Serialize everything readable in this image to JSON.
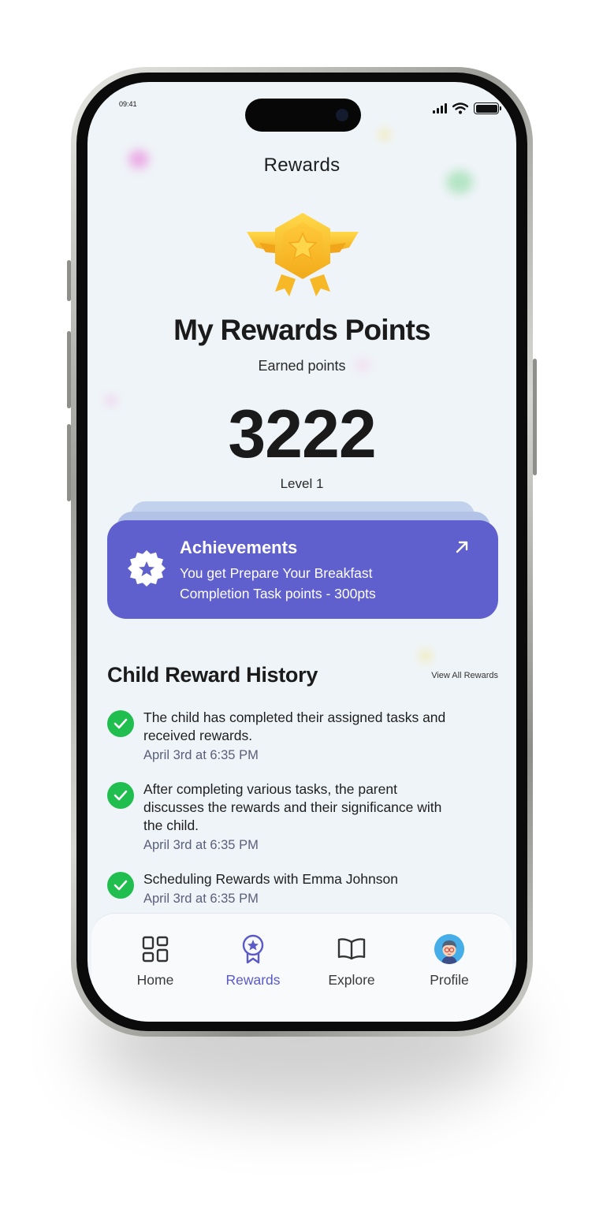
{
  "status_bar": {
    "time": "09:41"
  },
  "header": {
    "title": "Rewards"
  },
  "points": {
    "title": "My Rewards Points",
    "subtitle": "Earned points",
    "value": "3222",
    "level": "Level 1"
  },
  "achievement": {
    "title": "Achievements",
    "text": "You get Prepare Your Breakfast Completion Task points - 300pts"
  },
  "history": {
    "title": "Child Reward History",
    "view_all": "View All Rewards",
    "items": [
      {
        "text": "The child has completed their assigned tasks and received rewards.",
        "time": "April 3rd at 6:35 PM"
      },
      {
        "text": "After completing various tasks, the parent discusses the rewards and their significance with the child.",
        "time": "April 3rd at 6:35 PM"
      },
      {
        "text": "Scheduling Rewards with Emma Johnson",
        "time": "April 3rd at 6:35 PM"
      }
    ]
  },
  "tabs": [
    {
      "label": "Home",
      "icon": "grid-icon",
      "active": false
    },
    {
      "label": "Rewards",
      "icon": "medal-icon",
      "active": true
    },
    {
      "label": "Explore",
      "icon": "book-icon",
      "active": false
    },
    {
      "label": "Profile",
      "icon": "avatar",
      "active": false
    }
  ],
  "colors": {
    "accent": "#5f5fcd",
    "success": "#1fbe4f",
    "background": "#eff4f8"
  }
}
